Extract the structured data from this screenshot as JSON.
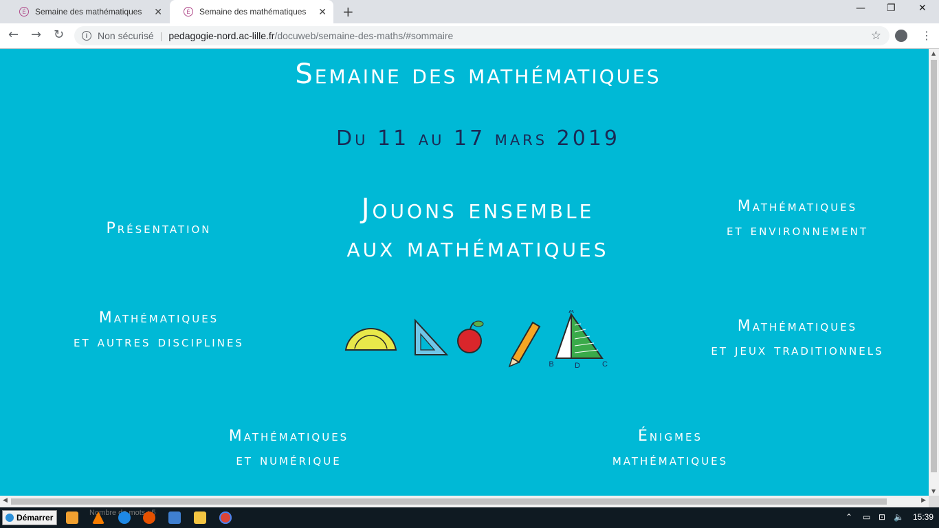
{
  "browser": {
    "tabs": [
      {
        "label": "Semaine des mathématiques",
        "active": false
      },
      {
        "label": "Semaine des mathématiques",
        "active": true
      }
    ],
    "new_tab": "+",
    "window_controls": {
      "minimize": "—",
      "maximize": "❐",
      "close": "✕"
    },
    "nav": {
      "back": "←",
      "forward": "→",
      "reload": "↻"
    },
    "address": {
      "security_label": "Non sécurisé",
      "host": "pedagogie-nord.ac-lille.fr",
      "path": "/docuweb/semaine-des-maths/#sommaire"
    },
    "icons": {
      "info": "info-icon",
      "star": "star-icon",
      "profile": "profile-icon",
      "menu": "menu-icon"
    }
  },
  "page": {
    "background": "#00b9d6",
    "title": "Semaine des mathématiques",
    "dates": "Du 11 au 17 mars 2019",
    "headline_line1": "Jouons ensemble",
    "headline_line2": "aux mathématiques",
    "links": {
      "presentation": "Présentation",
      "env_line1": "Mathématiques",
      "env_line2": "et environnement",
      "disc_line1": "Mathématiques",
      "disc_line2": "et autres disciplines",
      "jeux_line1": "Mathématiques",
      "jeux_line2": "et jeux traditionnels",
      "num_line1": "Mathématiques",
      "num_line2": "et numérique",
      "enig_line1": "Énigmes",
      "enig_line2": "mathématiques"
    },
    "triangle_labels": {
      "a": "A",
      "b": "B",
      "c": "C",
      "d": "D"
    }
  },
  "taskbar": {
    "start_label": "Démarrer",
    "clock": "15:39",
    "search_text": "Nombre de mots : 5"
  }
}
